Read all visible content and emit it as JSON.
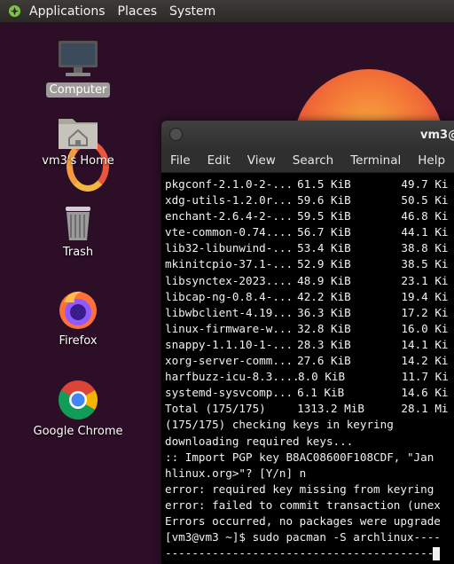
{
  "top_panel": {
    "applications": "Applications",
    "places": "Places",
    "system": "System"
  },
  "desktop_icons": {
    "computer": "Computer",
    "home": "vm3's Home",
    "trash": "Trash",
    "firefox": "Firefox",
    "chrome": "Google Chrome"
  },
  "terminal": {
    "title": "vm3@",
    "menu": [
      "File",
      "Edit",
      "View",
      "Search",
      "Terminal",
      "Help"
    ],
    "packages": [
      [
        "pkgconf-2.1.0-2-...",
        "61.5 KiB",
        "49.7 Ki"
      ],
      [
        "xdg-utils-1.2.0r...",
        "59.6 KiB",
        "50.5 Ki"
      ],
      [
        "enchant-2.6.4-2-...",
        "59.5 KiB",
        "46.8 Ki"
      ],
      [
        "vte-common-0.74....",
        "56.7 KiB",
        "44.1 Ki"
      ],
      [
        "lib32-libunwind-...",
        "53.4 KiB",
        "38.8 Ki"
      ],
      [
        "mkinitcpio-37.1-...",
        "52.9 KiB",
        "38.5 Ki"
      ],
      [
        "libsynctex-2023....",
        "48.9 KiB",
        "23.1 Ki"
      ],
      [
        "libcap-ng-0.8.4-...",
        "42.2 KiB",
        "19.4 Ki"
      ],
      [
        "libwbclient-4.19...",
        "36.3 KiB",
        "17.2 Ki"
      ],
      [
        "linux-firmware-w...",
        "32.8 KiB",
        "16.0 Ki"
      ],
      [
        "snappy-1.1.10-1-...",
        "28.3 KiB",
        "14.1 Ki"
      ],
      [
        "xorg-server-comm...",
        "27.6 KiB",
        "14.2 Ki"
      ],
      [
        "harfbuzz-icu-8.3....",
        "8.0 KiB",
        "11.7 Ki"
      ],
      [
        "systemd-sysvcomp...",
        "6.1 KiB",
        "14.6 Ki"
      ],
      [
        "Total (175/175)",
        "1313.2 MiB",
        "28.1 Mi"
      ]
    ],
    "lines": [
      "(175/175) checking keys in keyring",
      "downloading required keys...",
      ":: Import PGP key B8AC08600F108CDF, \"Jan",
      "hlinux.org>\"? [Y/n] n",
      "error: required key missing from keyring",
      "error: failed to commit transaction (unex",
      "Errors occurred, no packages were upgrade"
    ],
    "prompt": "[vm3@vm3 ~]$ sudo pacman -S archlinux----",
    "dashes": "-----------------------------------------"
  }
}
